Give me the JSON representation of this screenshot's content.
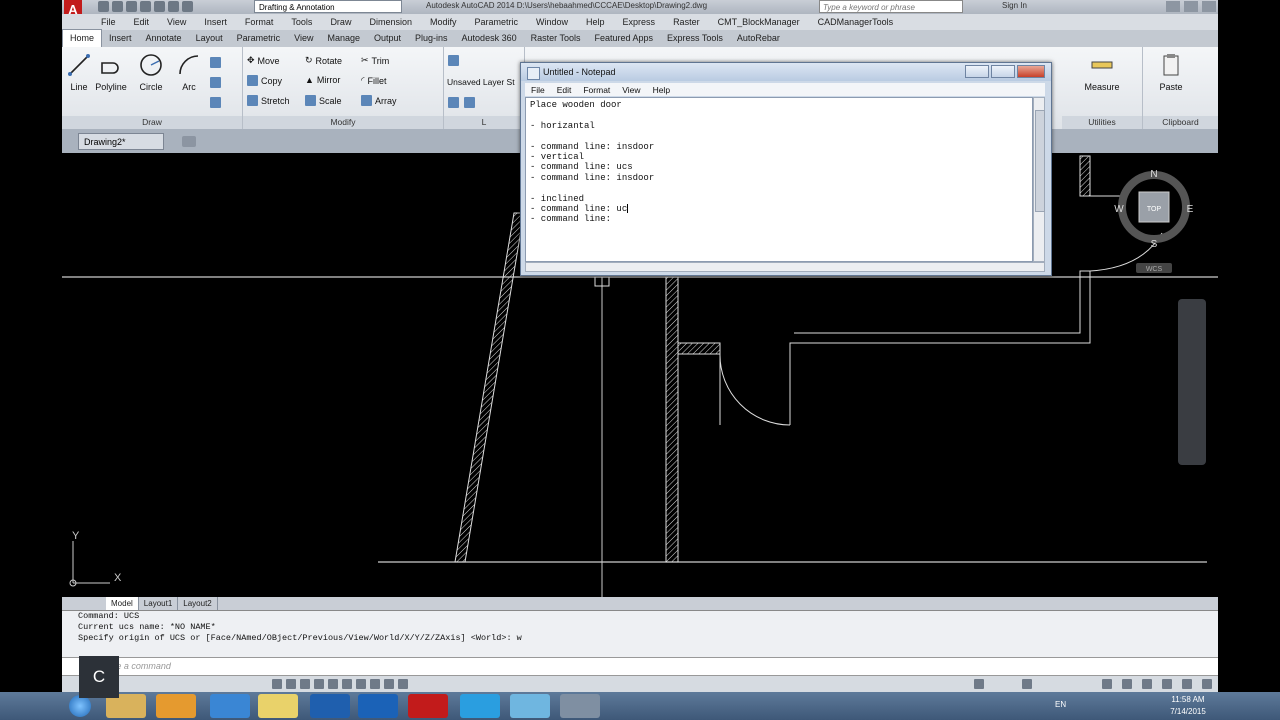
{
  "app": {
    "logo_letter": "A",
    "workspace": "Drafting & Annotation",
    "window_title": "Autodesk AutoCAD 2014    D:\\Users\\hebaahmed\\CCCAE\\Desktop\\Drawing2.dwg",
    "search_placeholder": "Type a keyword or phrase",
    "sign_in": "Sign In"
  },
  "menu": [
    "File",
    "Edit",
    "View",
    "Insert",
    "Format",
    "Tools",
    "Draw",
    "Dimension",
    "Modify",
    "Parametric",
    "Window",
    "Help",
    "Express",
    "Raster",
    "CMT_BlockManager",
    "CADManagerTools"
  ],
  "ribbon_tabs": [
    "Home",
    "Insert",
    "Annotate",
    "Layout",
    "Parametric",
    "View",
    "Manage",
    "Output",
    "Plug-ins",
    "Autodesk 360",
    "Raster Tools",
    "Featured Apps",
    "Express Tools",
    "AutoRebar"
  ],
  "ribbon": {
    "draw_title": "Draw",
    "draw_tools": [
      "Line",
      "Polyline",
      "Circle",
      "Arc"
    ],
    "modify_title": "Modify",
    "modify_tools": [
      "Move",
      "Rotate",
      "Trim",
      "Copy",
      "Mirror",
      "Fillet",
      "Stretch",
      "Scale",
      "Array"
    ],
    "layers_partial": "Unsaved Layer St",
    "layers_partial_title": "L",
    "utilities_tool": "Measure",
    "utilities_title": "Utilities",
    "clipboard_tool": "Paste",
    "clipboard_title": "Clipboard"
  },
  "document_tab": "Drawing2*",
  "viewcube": {
    "north": "N",
    "south": "S",
    "east": "E",
    "west": "W",
    "face": "TOP",
    "wcs": "WCS"
  },
  "ucs": {
    "x": "X",
    "y": "Y"
  },
  "layout_tabs": [
    "Model",
    "Layout1",
    "Layout2"
  ],
  "command_history": [
    "Command: UCS",
    "Current ucs name:  *NO NAME*",
    "Specify origin of UCS or [Face/NAmed/OBject/Previous/View/World/X/Y/Z/ZAxis] <World>: w"
  ],
  "command_placeholder": "Type a command",
  "overlay_letter": "C",
  "notepad": {
    "title": "Untitled - Notepad",
    "menu": [
      "File",
      "Edit",
      "Format",
      "View",
      "Help"
    ],
    "lines": [
      "Place wooden door",
      "",
      "- horizantal",
      "",
      "- command line: insdoor",
      "- vertical",
      "- command line: ucs",
      "- command line: insdoor",
      "",
      "- inclined",
      "- command line: uc",
      "- command line:"
    ]
  },
  "taskbar": {
    "language": "EN",
    "time": "11:58 AM",
    "date": "7/14/2015"
  },
  "colors": {
    "canvas": "#000000",
    "logo": "#c21b1b",
    "notepad_frame": "#cdd9e8"
  }
}
